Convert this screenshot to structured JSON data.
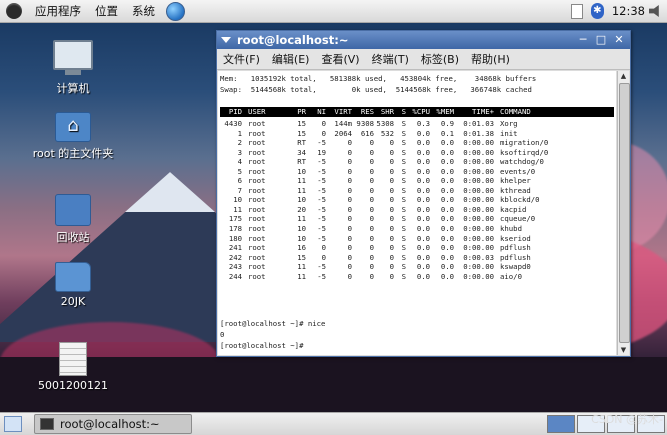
{
  "top_panel": {
    "menus": [
      "应用程序",
      "位置",
      "系统"
    ],
    "clock": "12:38"
  },
  "desktop": {
    "icons": [
      {
        "name": "computer",
        "label": "计算机"
      },
      {
        "name": "home-folder",
        "label": "root 的主文件夹"
      },
      {
        "name": "trash",
        "label": "回收站"
      },
      {
        "name": "folder",
        "label": "20JK"
      },
      {
        "name": "file",
        "label": "5001200121"
      }
    ]
  },
  "terminal": {
    "title": "root@localhost:~",
    "menus": [
      "文件(F)",
      "编辑(E)",
      "查看(V)",
      "终端(T)",
      "标签(B)",
      "帮助(H)"
    ],
    "mem_line": "Mem:   1035192k total,   581388k used,   453804k free,    34868k buffers",
    "swap_line": "Swap:  5144568k total,        0k used,  5144568k free,   366748k cached",
    "columns": [
      "PID",
      "USER",
      "PR",
      "NI",
      "VIRT",
      "RES",
      "SHR",
      "S",
      "%CPU",
      "%MEM",
      "TIME+",
      "COMMAND"
    ],
    "processes": [
      [
        "4430",
        "root",
        "15",
        "0",
        "144m",
        "9308",
        "5308",
        "S",
        "0.3",
        "0.9",
        "0:01.03",
        "Xorg"
      ],
      [
        "1",
        "root",
        "15",
        "0",
        "2064",
        "616",
        "532",
        "S",
        "0.0",
        "0.1",
        "0:01.38",
        "init"
      ],
      [
        "2",
        "root",
        "RT",
        "-5",
        "0",
        "0",
        "0",
        "S",
        "0.0",
        "0.0",
        "0:00.00",
        "migration/0"
      ],
      [
        "3",
        "root",
        "34",
        "19",
        "0",
        "0",
        "0",
        "S",
        "0.0",
        "0.0",
        "0:00.00",
        "ksoftirqd/0"
      ],
      [
        "4",
        "root",
        "RT",
        "-5",
        "0",
        "0",
        "0",
        "S",
        "0.0",
        "0.0",
        "0:00.00",
        "watchdog/0"
      ],
      [
        "5",
        "root",
        "10",
        "-5",
        "0",
        "0",
        "0",
        "S",
        "0.0",
        "0.0",
        "0:00.00",
        "events/0"
      ],
      [
        "6",
        "root",
        "11",
        "-5",
        "0",
        "0",
        "0",
        "S",
        "0.0",
        "0.0",
        "0:00.00",
        "khelper"
      ],
      [
        "7",
        "root",
        "11",
        "-5",
        "0",
        "0",
        "0",
        "S",
        "0.0",
        "0.0",
        "0:00.00",
        "kthread"
      ],
      [
        "10",
        "root",
        "10",
        "-5",
        "0",
        "0",
        "0",
        "S",
        "0.0",
        "0.0",
        "0:00.00",
        "kblockd/0"
      ],
      [
        "11",
        "root",
        "20",
        "-5",
        "0",
        "0",
        "0",
        "S",
        "0.0",
        "0.0",
        "0:00.00",
        "kacpid"
      ],
      [
        "175",
        "root",
        "11",
        "-5",
        "0",
        "0",
        "0",
        "S",
        "0.0",
        "0.0",
        "0:00.00",
        "cqueue/0"
      ],
      [
        "178",
        "root",
        "10",
        "-5",
        "0",
        "0",
        "0",
        "S",
        "0.0",
        "0.0",
        "0:00.00",
        "khubd"
      ],
      [
        "180",
        "root",
        "10",
        "-5",
        "0",
        "0",
        "0",
        "S",
        "0.0",
        "0.0",
        "0:00.00",
        "kseriod"
      ],
      [
        "241",
        "root",
        "16",
        "0",
        "0",
        "0",
        "0",
        "S",
        "0.0",
        "0.0",
        "0:00.00",
        "pdflush"
      ],
      [
        "242",
        "root",
        "15",
        "0",
        "0",
        "0",
        "0",
        "S",
        "0.0",
        "0.0",
        "0:00.03",
        "pdflush"
      ],
      [
        "243",
        "root",
        "11",
        "-5",
        "0",
        "0",
        "0",
        "S",
        "0.0",
        "0.0",
        "0:00.00",
        "kswapd0"
      ],
      [
        "244",
        "root",
        "11",
        "-5",
        "0",
        "0",
        "0",
        "S",
        "0.0",
        "0.0",
        "0:00.00",
        "aio/0"
      ]
    ],
    "prompt_line_1": "[root@localhost ~]# nice",
    "output_line": "0",
    "prompt_line_2": "[root@localhost ~]#"
  },
  "bottom_panel": {
    "task_label": "root@localhost:~"
  },
  "watermark": "CSDN @苏木-"
}
